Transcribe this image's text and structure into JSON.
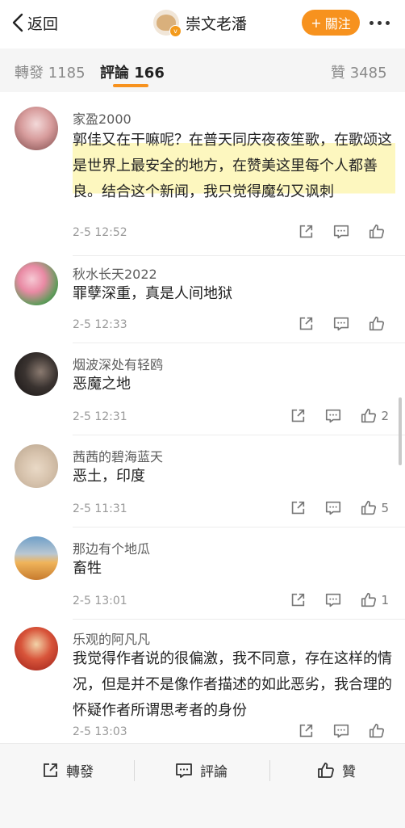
{
  "header": {
    "back_label": "返回",
    "title": "崇文老潘",
    "follow_label": "關注",
    "accent": "#f7921e"
  },
  "tabs": {
    "repost": "轉發 1185",
    "comments": "評論 166",
    "likes": "贊 3485"
  },
  "comments": [
    {
      "name": "家盈2000",
      "text": "郭佳又在干嘛呢？在普天同庆夜夜笙歌，在歌颂这是世界上最安全的地方，在赞美这里每个人都善良。结合这个新闻，我只觉得魔幻又讽刺",
      "time": "2-5 12:52",
      "likes": ""
    },
    {
      "name": "秋水长天2022",
      "text": "罪孽深重，真是人间地狱",
      "time": "2-5 12:33",
      "likes": ""
    },
    {
      "name": "烟波深处有轻鸥",
      "text": "恶魔之地",
      "time": "2-5 12:31",
      "likes": "2"
    },
    {
      "name": "茜茜的碧海蓝天",
      "text": "恶土，印度",
      "time": "2-5 11:31",
      "likes": "5"
    },
    {
      "name": "那边有个地瓜",
      "text": "畜牲",
      "time": "2-5 13:01",
      "likes": "1"
    },
    {
      "name": "乐观的阿凡凡",
      "text": "我觉得作者说的很偏激，我不同意，存在这样的情况，但是并不是像作者描述的如此恶劣，我合理的怀疑作者所谓思考者的身份",
      "time": "2-5 13:03",
      "likes": ""
    }
  ],
  "bottom": {
    "repost": "轉發",
    "comment": "評論",
    "like": "贊"
  },
  "icons": {
    "back": "chevron-left-icon",
    "more": "more-dots-icon",
    "repost": "share-icon",
    "comment": "comment-icon",
    "like": "thumbs-up-icon"
  }
}
